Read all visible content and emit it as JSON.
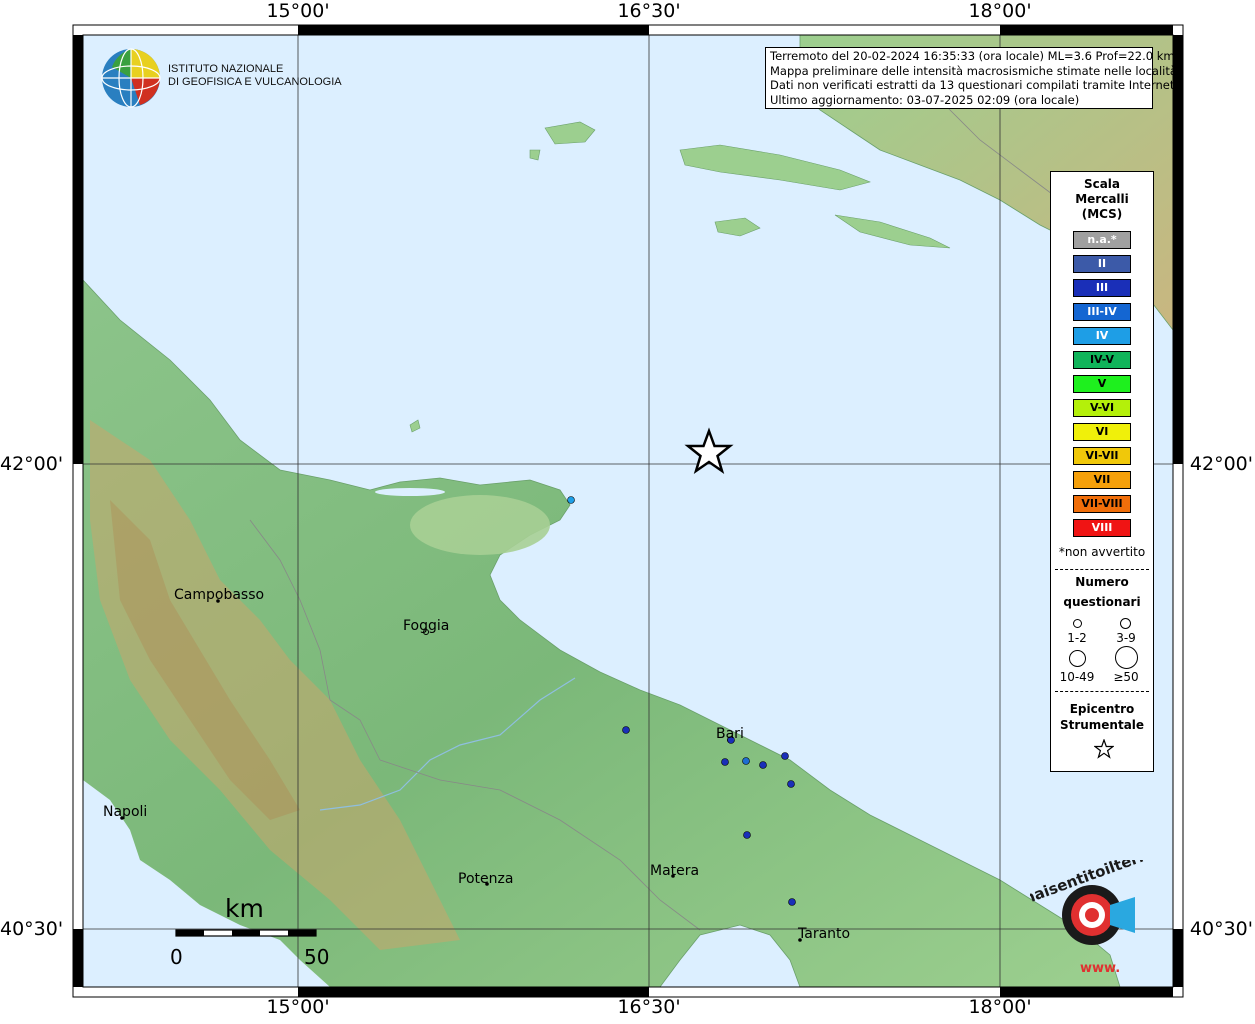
{
  "map": {
    "lon_ticks": [
      "15°00'",
      "16°30'",
      "18°00'"
    ],
    "lat_ticks": [
      "42°00'",
      "40°30'"
    ],
    "colors": {
      "sea": "#dcefff",
      "land_low": "#7fbf7f",
      "land_high": "#c9a66b",
      "frame": "#000000"
    }
  },
  "header_box": {
    "line1": "Terremoto del 20-02-2024 16:35:33 (ora locale) ML=3.6 Prof=22.0 km",
    "line2": "Mappa preliminare delle intensità macrosismiche stimate nelle località.",
    "line3": "Dati non verificati estratti da 13 questionari compilati tramite Internet.",
    "line4": "Ultimo aggiornamento: 03-07-2025 02:09 (ora locale)"
  },
  "logo": {
    "name_line1": "ISTITUTO NAZIONALE",
    "name_line2": "DI GEOFISICA E VULCANOLOGIA",
    "icon": "ingv-globe-icon"
  },
  "cities": [
    {
      "name": "Campobasso"
    },
    {
      "name": "Foggia"
    },
    {
      "name": "Bari"
    },
    {
      "name": "Napoli"
    },
    {
      "name": "Potenza"
    },
    {
      "name": "Matera"
    },
    {
      "name": "Taranto"
    }
  ],
  "legend": {
    "scale_title_1": "Scala",
    "scale_title_2": "Mercalli",
    "scale_title_3": "(MCS)",
    "classes": [
      {
        "label": "n.a.*",
        "color": "#a0a0a0"
      },
      {
        "label": "II",
        "color": "#3c5aa8"
      },
      {
        "label": "III",
        "color": "#1a2fb8"
      },
      {
        "label": "III-IV",
        "color": "#1466d2"
      },
      {
        "label": "IV",
        "color": "#1e9ee6"
      },
      {
        "label": "IV-V",
        "color": "#10b45a"
      },
      {
        "label": "V",
        "color": "#1ef01e"
      },
      {
        "label": "V-VI",
        "color": "#b4f00a"
      },
      {
        "label": "VI",
        "color": "#f0f00a"
      },
      {
        "label": "VI-VII",
        "color": "#f0c80a"
      },
      {
        "label": "VII",
        "color": "#f5a00a"
      },
      {
        "label": "VII-VIII",
        "color": "#f06e0a"
      },
      {
        "label": "VIII",
        "color": "#f01414"
      }
    ],
    "footnote": "*non avvertito",
    "count_title_1": "Numero",
    "count_title_2": "questionari",
    "count_classes": [
      "1-2",
      "3-9",
      "10-49",
      "≥50"
    ],
    "epi_title_1": "Epicentro",
    "epi_title_2": "Strumentale"
  },
  "scalebar": {
    "unit": "km",
    "start": "0",
    "end": "50"
  },
  "observations": [
    {
      "color": "#1e9ee6"
    },
    {
      "color": "#1a2fb8"
    },
    {
      "color": "#1a2fb8"
    },
    {
      "color": "#1a2fb8"
    },
    {
      "color": "#1e6ed2"
    },
    {
      "color": "#1a2fb8"
    },
    {
      "color": "#1a2fb8"
    },
    {
      "color": "#1a2fb8"
    },
    {
      "color": "#1a2fb8"
    },
    {
      "color": "#1a2fb8"
    }
  ],
  "site_logo": {
    "text": "haisentitoilterremoto.it",
    "url_text": "www."
  }
}
